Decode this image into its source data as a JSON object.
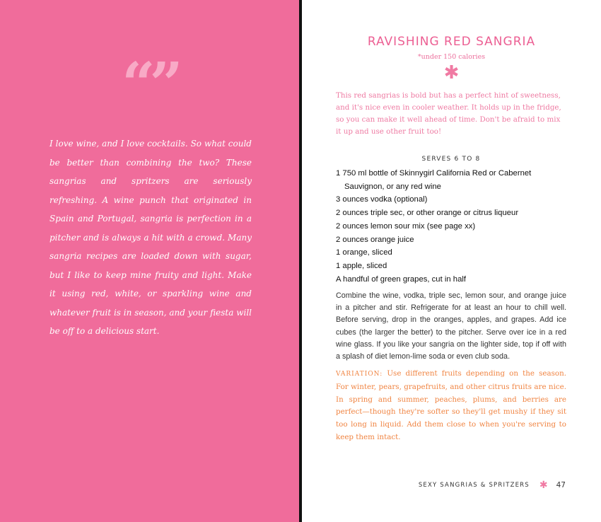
{
  "left_page": {
    "quote_mark": "“”",
    "intro_text": "I love wine, and I love cocktails. So what could be better than combining the two? These sangrias and spritzers are seriously refreshing. A wine punch that originated in Spain and Portugal, sangria is perfection in a pitcher and is always a hit with a crowd. Many sangria recipes are loaded down with sugar, but I like to keep mine fruity and light. Make it using red, white, or sparkling wine and whatever fruit is in season, and your fiesta will be off to a delicious start."
  },
  "recipe": {
    "title": "RAVISHING RED SANGRIA",
    "subtitle": "*under 150 calories",
    "ornament": "✱",
    "description": "This red sangrias is bold but has a perfect hint of sweetness, and it's nice even in cooler weather. It holds up in the fridge, so you can make it well ahead of time. Don't be afraid to mix it up and use other fruit too!",
    "serves": "SERVES 6 TO 8",
    "ingredients": [
      "1 750 ml bottle of Skinnygirl California Red or Cabernet",
      "Sauvignon, or any red wine",
      "3 ounces vodka (optional)",
      "2 ounces triple sec, or other orange or citrus liqueur",
      "2 ounces lemon sour mix (see page xx)",
      "2 ounces orange juice",
      "1 orange, sliced",
      "1 apple, sliced",
      "A handful of green grapes, cut in half"
    ],
    "directions": "Combine the wine, vodka, triple sec, lemon sour, and orange juice in a pitcher and stir. Refrigerate for at least an hour to chill well. Before serving, drop in the oranges, apples, and grapes. Add ice cubes (the larger the better) to the pitcher. Serve over ice in a red wine glass. If you like your sangria on the lighter side, top if off with a splash of diet lemon-lime soda or even club soda.",
    "variation_label": "VARIATION:",
    "variation_text": "Use different fruits depending on the season. For winter, pears, grapefruits, and other citrus fruits are nice. In spring and summer, peaches, plums, and berries are perfect—though they're softer so they'll get mushy if they sit too long in liquid. Add them close to when you're serving to keep them intact."
  },
  "footer": {
    "section": "SEXY SANGRIAS & SPRITZERS",
    "ornament": "✱",
    "page_number": "47"
  },
  "colors": {
    "left_page_bg": "#f06c9b",
    "title_pink": "#ec5f93",
    "variation_orange": "#f08442"
  }
}
